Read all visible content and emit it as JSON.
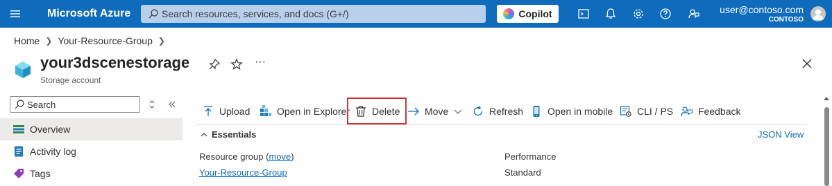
{
  "topbar": {
    "brand": "Microsoft Azure",
    "search_placeholder": "Search resources, services, and docs (G+/)",
    "copilot_label": "Copilot",
    "user_email": "user@contoso.com",
    "user_tenant": "CONTOSO",
    "icons": [
      "cloud-shell-icon",
      "bell-icon",
      "gear-icon",
      "help-icon",
      "feedback-icon"
    ]
  },
  "breadcrumb": {
    "items": [
      "Home",
      "Your-Resource-Group"
    ]
  },
  "resource": {
    "title": "your3dscenestorage",
    "subtitle": "Storage account",
    "more": "···"
  },
  "sidebar": {
    "search_placeholder": "Search",
    "items": [
      {
        "label": "Overview",
        "icon": "overview-icon",
        "active": true
      },
      {
        "label": "Activity log",
        "icon": "activity-log-icon",
        "active": false
      },
      {
        "label": "Tags",
        "icon": "tag-icon",
        "active": false
      }
    ]
  },
  "toolbar": {
    "upload": "Upload",
    "open_explorer": "Open in Explorer",
    "delete": "Delete",
    "move": "Move",
    "refresh": "Refresh",
    "open_mobile": "Open in mobile",
    "cli_ps": "CLI / PS",
    "feedback": "Feedback"
  },
  "essentials": {
    "header": "Essentials",
    "json_view": "JSON View",
    "resource_group_label": "Resource group (",
    "move_link": "move",
    "resource_group_close": ")",
    "resource_group_value": "Your-Resource-Group",
    "performance_label": "Performance",
    "performance_value": "Standard"
  },
  "colors": {
    "azure_blue": "#0f6cbd",
    "highlight_red": "#d13438"
  }
}
